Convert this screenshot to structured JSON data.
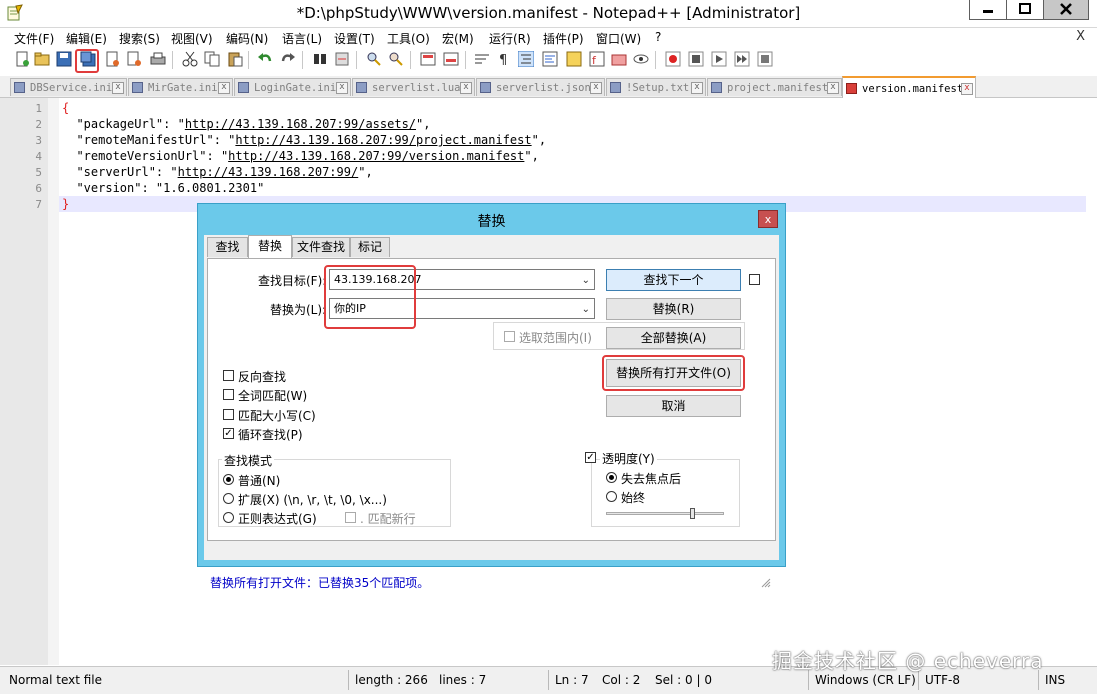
{
  "window": {
    "title": "*D:\\phpStudy\\WWW\\version.manifest - Notepad++ [Administrator]",
    "close_label": "X"
  },
  "menu": {
    "items": [
      "文件(F)",
      "编辑(E)",
      "搜索(S)",
      "视图(V)",
      "编码(N)",
      "语言(L)",
      "设置(T)",
      "工具(O)",
      "宏(M)",
      "运行(R)",
      "插件(P)",
      "窗口(W)",
      "?"
    ],
    "close": "X"
  },
  "toolbar": {
    "icons": [
      "new-file-icon",
      "open-file-icon",
      "save-icon",
      "save-all-icon",
      "close-icon",
      "close-all-icon",
      "print-icon",
      "cut-icon",
      "copy-icon",
      "paste-icon",
      "undo-icon",
      "redo-icon",
      "find-icon",
      "replace-icon",
      "zoom-in-icon",
      "zoom-out-icon",
      "sync-v-icon",
      "sync-h-icon",
      "word-wrap-icon",
      "all-chars-icon",
      "indent-guide-icon",
      "lang-icon",
      "doc-map-icon",
      "function-list-icon",
      "folder-workspace-icon",
      "monitor-icon",
      "record-macro-icon",
      "stop-macro-icon",
      "play-macro-icon",
      "run-multiple-macro-icon",
      "save-macro-icon"
    ]
  },
  "tabs": [
    {
      "label": "DBService.ini",
      "active": false
    },
    {
      "label": "MirGate.ini",
      "active": false
    },
    {
      "label": "LoginGate.ini",
      "active": false
    },
    {
      "label": "serverlist.lua",
      "active": false
    },
    {
      "label": "serverlist.json",
      "active": false
    },
    {
      "label": "!Setup.txt",
      "active": false
    },
    {
      "label": "project.manifest",
      "active": false
    },
    {
      "label": "version.manifest",
      "active": true
    }
  ],
  "editor": {
    "line_numbers": [
      "1",
      "2",
      "3",
      "4",
      "5",
      "6",
      "7"
    ],
    "lines": [
      {
        "pre": "{",
        "url": "",
        "post": ""
      },
      {
        "pre": "  \"packageUrl\": \"",
        "url": "http://43.139.168.207:99/assets/",
        "post": "\","
      },
      {
        "pre": "  \"remoteManifestUrl\": \"",
        "url": "http://43.139.168.207:99/project.manifest",
        "post": "\","
      },
      {
        "pre": "  \"remoteVersionUrl\": \"",
        "url": "http://43.139.168.207:99/version.manifest",
        "post": "\","
      },
      {
        "pre": "  \"serverUrl\": \"",
        "url": "http://43.139.168.207:99/",
        "post": "\","
      },
      {
        "pre": "  \"version\": \"1.6.0801.2301\"",
        "url": "",
        "post": ""
      },
      {
        "pre": "}",
        "url": "",
        "post": ""
      }
    ]
  },
  "dialog": {
    "title": "替换",
    "close": "x",
    "tabs": [
      "查找",
      "替换",
      "文件查找",
      "标记"
    ],
    "find_label": "查找目标(F):",
    "find_value": "43.139.168.207",
    "replace_label": "替换为(L):",
    "replace_value": "你的IP",
    "in_selection_label": "选取范围内(I)",
    "buttons": {
      "find_next": "查找下一个",
      "replace": "替换(R)",
      "replace_all": "全部替换(A)",
      "replace_all_open": "替换所有打开文件(O)",
      "cancel": "取消"
    },
    "options": {
      "backward": "反向查找",
      "whole_word": "全词匹配(W)",
      "match_case": "匹配大小写(C)",
      "wrap": "循环查找(P)"
    },
    "search_mode": {
      "title": "查找模式",
      "normal": "普通(N)",
      "extended": "扩展(X) (\\n, \\r, \\t, \\0, \\x...)",
      "regex": "正则表达式(G)",
      "dot_newline": ". 匹配新行"
    },
    "transparency": {
      "title": "透明度(Y)",
      "on_lose_focus": "失去焦点后",
      "always": "始终",
      "level": 0.75
    },
    "status": "替换所有打开文件：已替换35个匹配项。"
  },
  "statusbar": {
    "file_type": "Normal text file",
    "length": "length : 266",
    "lines": "lines : 7",
    "ln": "Ln : 7",
    "col": "Col : 2",
    "sel": "Sel : 0 | 0",
    "eol": "Windows (CR LF)",
    "encoding": "UTF-8",
    "mode": "INS"
  },
  "watermark": "掘金技术社区 @ echeverra"
}
